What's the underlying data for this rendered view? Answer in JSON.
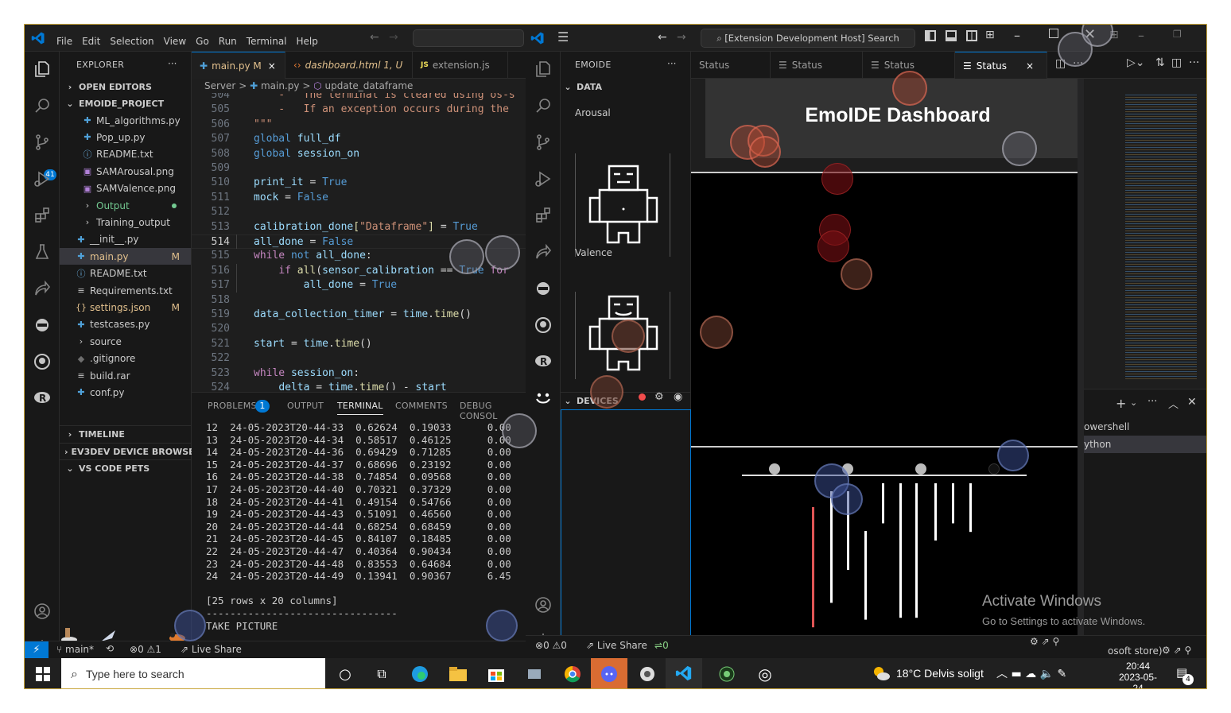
{
  "left": {
    "menu": [
      "File",
      "Edit",
      "Selection",
      "View",
      "Go",
      "Run",
      "Terminal",
      "Help"
    ],
    "explorer": {
      "title": "EXPLORER",
      "more": "···",
      "open_editors": "OPEN EDITORS",
      "project": "EMOIDE_PROJECT",
      "files": [
        {
          "label": "ML_algorithms.py",
          "icon": "python-icon",
          "indent": 1,
          "color": "#cccccc"
        },
        {
          "label": "Pop_up.py",
          "icon": "python-icon",
          "indent": 1,
          "color": "#cccccc"
        },
        {
          "label": "README.txt",
          "icon": "info-icon",
          "indent": 1,
          "color": "#cccccc"
        },
        {
          "label": "SAMArousal.png",
          "icon": "image-icon",
          "indent": 1,
          "color": "#cccccc"
        },
        {
          "label": "SAMValence.png",
          "icon": "image-icon",
          "indent": 1,
          "color": "#cccccc"
        },
        {
          "label": "Output",
          "icon": "chevron-right-icon",
          "indent": 1,
          "color": "#73c991"
        },
        {
          "label": "Training_output",
          "icon": "chevron-right-icon",
          "indent": 1,
          "color": "#cccccc"
        },
        {
          "label": "__init__.py",
          "icon": "python-icon",
          "indent": 0,
          "color": "#cccccc"
        },
        {
          "label": "main.py",
          "icon": "python-icon",
          "indent": 0,
          "color": "#e2c08d",
          "badge": "M"
        },
        {
          "label": "README.txt",
          "icon": "info-icon",
          "indent": 0,
          "color": "#cccccc"
        },
        {
          "label": "Requirements.txt",
          "icon": "lines-icon",
          "indent": 0,
          "color": "#cccccc"
        },
        {
          "label": "settings.json",
          "icon": "braces-icon",
          "indent": 0,
          "color": "#e2c08d",
          "badge": "M"
        },
        {
          "label": "testcases.py",
          "icon": "python-icon",
          "indent": 0,
          "color": "#cccccc"
        },
        {
          "label": "source",
          "icon": "chevron-right-icon",
          "indent": 0,
          "color": "#cccccc"
        },
        {
          "label": ".gitignore",
          "icon": "git-icon",
          "indent": 0,
          "color": "#cccccc"
        },
        {
          "label": "build.rar",
          "icon": "lines-icon",
          "indent": 0,
          "color": "#cccccc"
        },
        {
          "label": "conf.py",
          "icon": "python-icon",
          "indent": 0,
          "color": "#cccccc"
        }
      ],
      "sections": [
        "TIMELINE",
        "EV3DEV DEVICE BROWSER",
        "VS CODE PETS"
      ]
    },
    "tabs": [
      {
        "label": "main.py",
        "suffix": "M",
        "active": true,
        "close": "×"
      },
      {
        "label": "dashboard.html",
        "suffix": "1, U",
        "active": false
      },
      {
        "label": "extension.js",
        "suffix": "",
        "active": false
      }
    ],
    "breadcrumb": [
      "Server",
      ">",
      "main.py",
      ">",
      "update_dataframe"
    ],
    "code": [
      {
        "n": "504",
        "html": "<span class='str'>    -   The terminal is cleared using os-s</span>"
      },
      {
        "n": "505",
        "html": "<span class='str'>    -   If an exception occurs during the</span>"
      },
      {
        "n": "506",
        "html": "<span class='str'>\"\"\"</span>"
      },
      {
        "n": "507",
        "html": "<span class='kw'>global</span> <span class='var'>full_df</span>"
      },
      {
        "n": "508",
        "html": "<span class='kw'>global</span> <span class='var'>session_on</span>"
      },
      {
        "n": "509",
        "html": ""
      },
      {
        "n": "510",
        "html": "<span class='var'>print_it</span> <span class='tx'>=</span> <span class='kw'>True</span>"
      },
      {
        "n": "511",
        "html": "<span class='var'>mock</span> <span class='tx'>=</span> <span class='kw'>False</span>"
      },
      {
        "n": "512",
        "html": ""
      },
      {
        "n": "513",
        "html": "<span class='var'>calibration_done</span><span class='fn'>[</span><span class='str'>\"Dataframe\"</span><span class='fn'>]</span> <span class='tx'>=</span> <span class='kw'>True</span>"
      },
      {
        "n": "514",
        "html": "<span class='var'>all_done</span> <span class='tx'>=</span> <span class='kw'>False</span>",
        "cur": true
      },
      {
        "n": "515",
        "html": "<span class='kw2'>while</span> <span class='kw'>not</span> <span class='var'>all_done</span><span class='tx'>:</span>"
      },
      {
        "n": "516",
        "html": "    <span class='kw2'>if</span> <span class='fn'>all</span><span class='tx'>(</span><span class='var'>sensor_calibration</span> <span class='tx'>==</span> <span class='kw'>True</span> <span class='kw2'>for</span>"
      },
      {
        "n": "517",
        "html": "        <span class='var'>all_done</span> <span class='tx'>=</span> <span class='kw'>True</span>"
      },
      {
        "n": "518",
        "html": ""
      },
      {
        "n": "519",
        "html": "<span class='var'>data_collection_timer</span> <span class='tx'>=</span> <span class='var'>time</span><span class='tx'>.</span><span class='fn'>time</span><span class='tx'>()</span>"
      },
      {
        "n": "520",
        "html": ""
      },
      {
        "n": "521",
        "html": "<span class='var'>start</span> <span class='tx'>=</span> <span class='var'>time</span><span class='tx'>.</span><span class='fn'>time</span><span class='tx'>()</span>"
      },
      {
        "n": "522",
        "html": ""
      },
      {
        "n": "523",
        "html": "<span class='kw2'>while</span> <span class='var'>session_on</span><span class='tx'>:</span>"
      },
      {
        "n": "524",
        "html": "    <span class='var'>delta</span> <span class='tx'>=</span> <span class='var'>time</span><span class='tx'>.</span><span class='fn'>time</span><span class='tx'>() - </span><span class='var'>start</span>"
      }
    ],
    "panel_tabs": {
      "problems": "PROBLEMS",
      "problems_count": "1",
      "output": "OUTPUT",
      "terminal": "TERMINAL",
      "comments": "COMMENTS",
      "debug": "DEBUG CONSOL"
    },
    "terminal": [
      "12  24-05-2023T20-44-33  0.62624  0.19033      0.00",
      "13  24-05-2023T20-44-34  0.58517  0.46125      0.00",
      "14  24-05-2023T20-44-36  0.69429  0.71285      0.00",
      "15  24-05-2023T20-44-37  0.68696  0.23192      0.00",
      "16  24-05-2023T20-44-38  0.74854  0.09568      0.00",
      "17  24-05-2023T20-44-40  0.70321  0.37329      0.00",
      "18  24-05-2023T20-44-41  0.49154  0.54766      0.00",
      "19  24-05-2023T20-44-43  0.51091  0.46560      0.00",
      "20  24-05-2023T20-44-44  0.68254  0.68459      0.00",
      "21  24-05-2023T20-44-45  0.84107  0.18485      0.00",
      "22  24-05-2023T20-44-47  0.40364  0.90434      0.00",
      "23  24-05-2023T20-44-48  0.83553  0.64684      0.00",
      "24  24-05-2023T20-44-49  0.13941  0.90367      6.45",
      "",
      "[25 rows x 20 columns]",
      "--------------------------------",
      "TAKE PICTURE"
    ],
    "status": {
      "branch": "main*",
      "errors": "0",
      "warnings": "1",
      "live_share": "Live Share"
    },
    "activity_badge": "41"
  },
  "right": {
    "search": "[Extension Development Host] Search",
    "emoide": {
      "title": "EMOIDE",
      "more": "···",
      "data_section": "DATA",
      "arousal": "Arousal",
      "valence": "Valence",
      "devices_section": "DEVICES"
    },
    "tabs": [
      {
        "label": "Status",
        "active": false
      },
      {
        "label": "Status",
        "active": false
      },
      {
        "label": "Status",
        "active": false
      },
      {
        "label": "Status",
        "active": true,
        "close": "×"
      }
    ],
    "dashboard_title": "EmoIDE Dashboard",
    "bar_values": [
      0.84,
      0.78,
      0.55,
      0.62,
      0.28,
      0.94,
      0.94,
      0.4,
      0.28,
      0.34
    ],
    "bar_colors": [
      "#e05555",
      "#ffffff",
      "#ffffff",
      "#ffffff",
      "#ffffff",
      "#ffffff",
      "#ffffff",
      "#ffffff",
      "#ffffff",
      "#ffffff"
    ],
    "panel_right": {
      "powershell": "owershell",
      "python": "ython",
      "plus": "+"
    },
    "activate_title": "Activate Windows",
    "activate_sub": "Go to Settings to activate Windows.",
    "status": {
      "errors": "0",
      "warnings": "0",
      "live_share": "Live Share",
      "ports": "0",
      "store": "osoft store)"
    }
  },
  "taskbar": {
    "search_placeholder": "Type here to search",
    "weather": "18°C  Delvis soligt",
    "time": "20:44",
    "date": "2023-05-24",
    "notif": "4"
  }
}
